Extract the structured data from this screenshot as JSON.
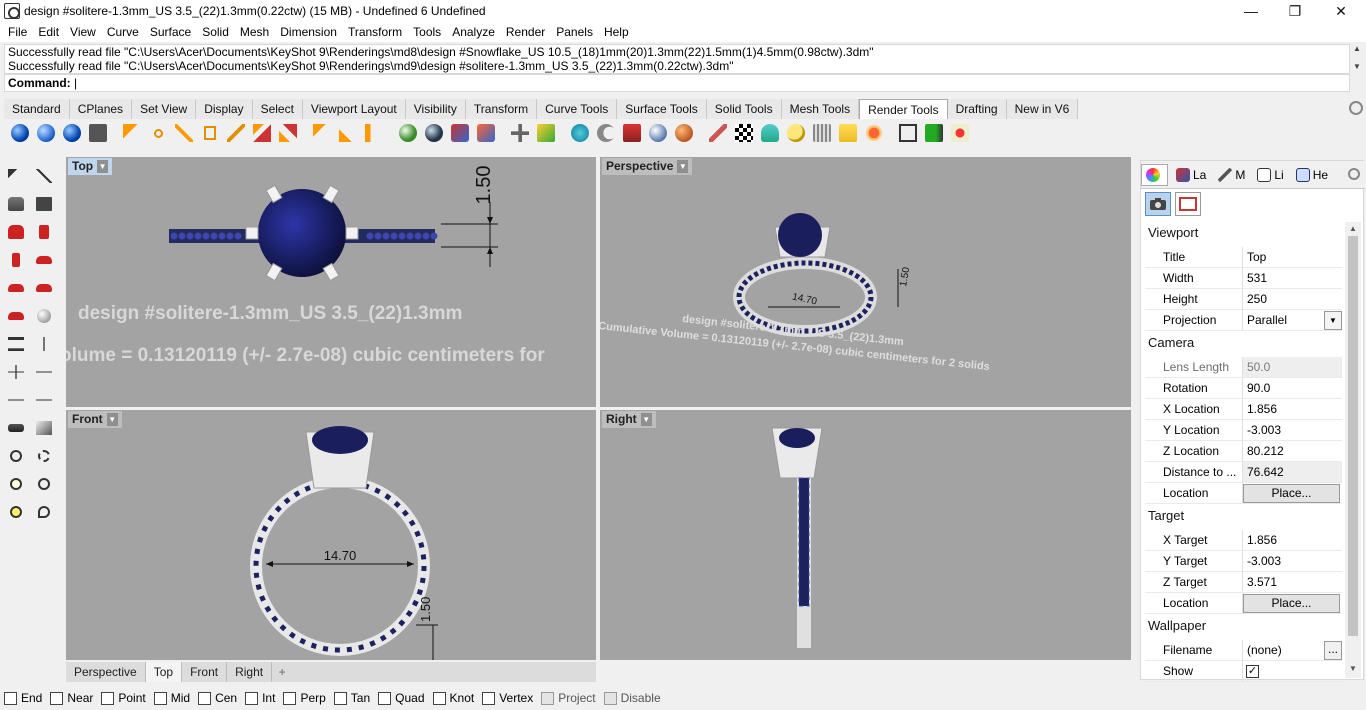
{
  "window": {
    "title": "design #solitere-1.3mm_US 3.5_(22)1.3mm(0.22ctw) (15 MB) - Undefined 6 Undefined",
    "minimize": "—",
    "maximize": "❐",
    "close": "✕"
  },
  "menu": [
    "File",
    "Edit",
    "View",
    "Curve",
    "Surface",
    "Solid",
    "Mesh",
    "Dimension",
    "Transform",
    "Tools",
    "Analyze",
    "Render",
    "Panels",
    "Help"
  ],
  "command_history": [
    "Successfully read file \"C:\\Users\\Acer\\Documents\\KeyShot 9\\Renderings\\md8\\design #Snowflake_US 10.5_(18)1mm(20)1.3mm(22)1.5mm(1)4.5mm(0.98ctw).3dm\"",
    "Successfully read file \"C:\\Users\\Acer\\Documents\\KeyShot 9\\Renderings\\md9\\design #solitere-1.3mm_US 3.5_(22)1.3mm(0.22ctw).3dm\""
  ],
  "command_prompt": "Command:",
  "toolbar_tabs": [
    "Standard",
    "CPlanes",
    "Set View",
    "Display",
    "Select",
    "Viewport Layout",
    "Visibility",
    "Transform",
    "Curve Tools",
    "Surface Tools",
    "Solid Tools",
    "Mesh Tools",
    "Render Tools",
    "Drafting",
    "New in V6"
  ],
  "active_toolbar_tab": "Render Tools",
  "viewports": {
    "top": {
      "label": "Top",
      "dim": "1.50",
      "text1": "design #solitere-1.3mm_US 3.5_(22)1.3mm",
      "text2": "olume = 0.13120119 (+/- 2.7e-08) cubic centimeters for"
    },
    "perspective": {
      "label": "Perspective",
      "dim_a": "14.70",
      "dim_b": "1.50",
      "text1": "design #solitere-1.3mm_US 3.5_(22)1.3mm",
      "text2": "Cumulative Volume = 0.13120119 (+/- 2.7e-08) cubic centimeters for 2 solids"
    },
    "front": {
      "label": "Front",
      "dim_a": "14.70",
      "dim_b": "1.50"
    },
    "right": {
      "label": "Right"
    }
  },
  "viewport_tabs": [
    "Perspective",
    "Top",
    "Front",
    "Right"
  ],
  "active_viewport_tab": "Top",
  "osnaps": [
    {
      "label": "End",
      "disabled": false
    },
    {
      "label": "Near",
      "disabled": false
    },
    {
      "label": "Point",
      "disabled": false
    },
    {
      "label": "Mid",
      "disabled": false
    },
    {
      "label": "Cen",
      "disabled": false
    },
    {
      "label": "Int",
      "disabled": false
    },
    {
      "label": "Perp",
      "disabled": false
    },
    {
      "label": "Tan",
      "disabled": false
    },
    {
      "label": "Quad",
      "disabled": false
    },
    {
      "label": "Knot",
      "disabled": false
    },
    {
      "label": "Vertex",
      "disabled": false
    },
    {
      "label": "Project",
      "disabled": true
    },
    {
      "label": "Disable",
      "disabled": true
    }
  ],
  "panel": {
    "tabs": [
      {
        "label": "",
        "icon": "color-wheel-icon"
      },
      {
        "label": "La",
        "icon": "layers-icon"
      },
      {
        "label": "M",
        "icon": "materials-icon"
      },
      {
        "label": "Li",
        "icon": "libraries-icon"
      },
      {
        "label": "He",
        "icon": "help-icon"
      }
    ],
    "sections": {
      "viewport": "Viewport",
      "camera": "Camera",
      "target": "Target",
      "wallpaper": "Wallpaper"
    },
    "viewport": {
      "title_k": "Title",
      "title_v": "Top",
      "width_k": "Width",
      "width_v": "531",
      "height_k": "Height",
      "height_v": "250",
      "projection_k": "Projection",
      "projection_v": "Parallel"
    },
    "camera": {
      "lens_k": "Lens Length",
      "lens_v": "50.0",
      "rotation_k": "Rotation",
      "rotation_v": "90.0",
      "xloc_k": "X Location",
      "xloc_v": "1.856",
      "yloc_k": "Y Location",
      "yloc_v": "-3.003",
      "zloc_k": "Z Location",
      "zloc_v": "80.212",
      "dist_k": "Distance to ...",
      "dist_v": "76.642",
      "location_k": "Location",
      "location_btn": "Place..."
    },
    "target": {
      "x_k": "X Target",
      "x_v": "1.856",
      "y_k": "Y Target",
      "y_v": "-3.003",
      "z_k": "Z Target",
      "z_v": "3.571",
      "location_k": "Location",
      "location_btn": "Place..."
    },
    "wallpaper": {
      "filename_k": "Filename",
      "filename_v": "(none)",
      "browse": "...",
      "show_k": "Show",
      "show_v": "✓"
    }
  },
  "colors": {
    "viewport_bg": "#a3a3a3",
    "gem": "#1b1e5c",
    "metal": "#e6e6e6"
  }
}
